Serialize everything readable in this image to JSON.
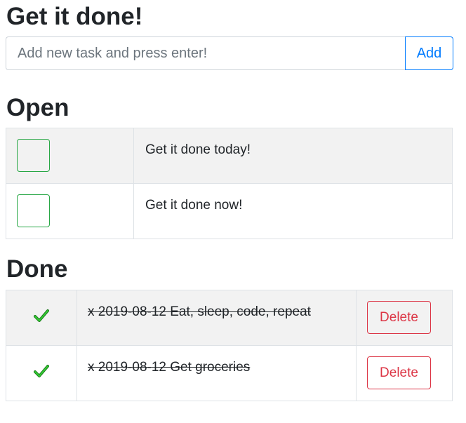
{
  "header": {
    "title": "Get it done!"
  },
  "add_task": {
    "placeholder": "Add new task and press enter!",
    "button_label": "Add"
  },
  "open": {
    "title": "Open",
    "tasks": [
      {
        "text": "Get it done today!"
      },
      {
        "text": "Get it done now!"
      }
    ]
  },
  "done": {
    "title": "Done",
    "tasks": [
      {
        "text": "x 2019-08-12 Eat, sleep, code, repeat",
        "delete_label": "Delete"
      },
      {
        "text": "x 2019-08-12 Get groceries",
        "delete_label": "Delete"
      }
    ]
  },
  "colors": {
    "primary": "#007bff",
    "success": "#28a745",
    "danger": "#dc3545",
    "stripe": "#f2f2f2"
  },
  "icons": {
    "done_mark": "check-icon"
  }
}
